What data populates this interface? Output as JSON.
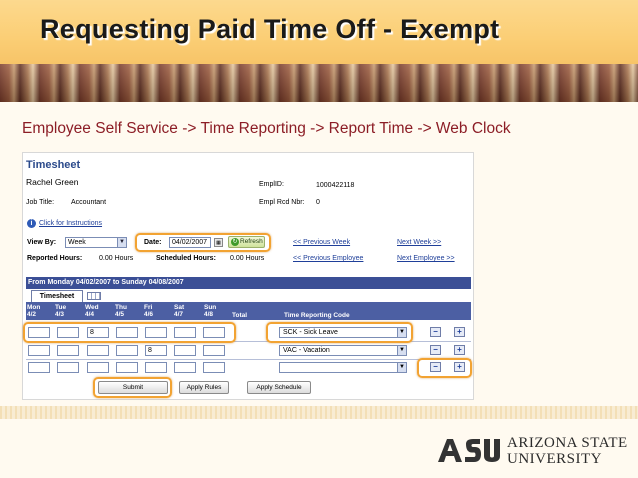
{
  "slide": {
    "title": "Requesting Paid Time Off - Exempt",
    "breadcrumb": "Employee Self Service -> Time Reporting -> Report Time -> Web Clock"
  },
  "timesheet": {
    "title": "Timesheet",
    "employee_name": "Rachel Green",
    "empl_id_label": "EmplID:",
    "empl_id": "1000422118",
    "job_title_label": "Job Title:",
    "job_title": "Accountant",
    "empl_rcd_label": "Empl Rcd Nbr:",
    "empl_rcd": "0",
    "instructions_link": "Click for Instructions",
    "view_by_label": "View By:",
    "view_by_value": "Week",
    "date_label": "Date:",
    "date_value": "04/02/2007",
    "refresh_label": "Refresh",
    "prev_week": "<< Previous Week",
    "next_week": "Next Week >>",
    "reported_hours_label": "Reported Hours:",
    "reported_hours": "0.00 Hours",
    "scheduled_hours_label": "Scheduled Hours:",
    "scheduled_hours": "0.00 Hours",
    "prev_employee": "<< Previous Employee",
    "next_employee": "Next Employee >>",
    "period": "From Monday 04/02/2007 to Sunday 04/08/2007",
    "tab_label": "Timesheet",
    "days": [
      {
        "name": "Mon",
        "date": "4/2"
      },
      {
        "name": "Tue",
        "date": "4/3"
      },
      {
        "name": "Wed",
        "date": "4/4"
      },
      {
        "name": "Thu",
        "date": "4/5"
      },
      {
        "name": "Fri",
        "date": "4/6"
      },
      {
        "name": "Sat",
        "date": "4/7"
      },
      {
        "name": "Sun",
        "date": "4/8"
      }
    ],
    "total_label": "Total",
    "trc_label": "Time Reporting Code",
    "rows": [
      {
        "values": [
          "",
          "",
          "8",
          "",
          "",
          "",
          ""
        ],
        "code": "SCK - Sick Leave"
      },
      {
        "values": [
          "",
          "",
          "",
          "",
          "8",
          "",
          ""
        ],
        "code": "VAC - Vacation"
      },
      {
        "values": [
          "",
          "",
          "",
          "",
          "",
          "",
          ""
        ],
        "code": ""
      }
    ],
    "submit_label": "Submit",
    "apply_rules_label": "Apply Rules",
    "apply_schedule_label": "Apply Schedule",
    "minus_glyph": "−",
    "plus_glyph": "+"
  },
  "footer": {
    "logo_letters": "ASU",
    "university_line1": "ARIZONA STATE",
    "university_line2": "UNIVERSITY"
  },
  "colors": {
    "title_band": "#fbce75",
    "breadcrumb": "#8c1d26",
    "highlight": "#f2a332",
    "grid_header": "#4c5fa3"
  }
}
